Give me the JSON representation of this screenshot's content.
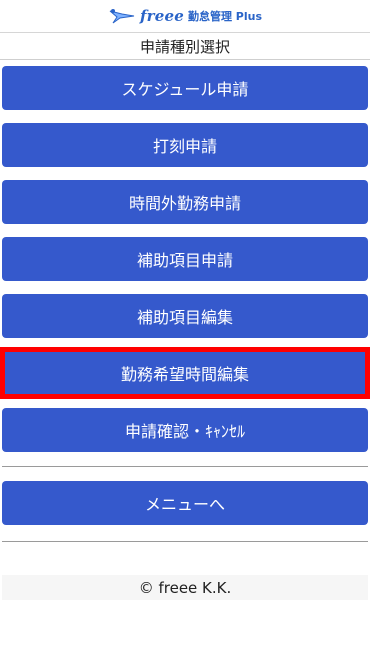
{
  "header": {
    "brand": "freee",
    "product": "勤怠管理 Plus",
    "logo_icon": "freee-bird-logo"
  },
  "page_title": "申請種別選択",
  "menu": {
    "items": [
      {
        "label": "スケジュール申請"
      },
      {
        "label": "打刻申請"
      },
      {
        "label": "時間外勤務申請"
      },
      {
        "label": "補助項目申請"
      },
      {
        "label": "補助項目編集"
      },
      {
        "label": "勤務希望時間編集",
        "highlighted": true
      },
      {
        "label": "申請確認・ｷｬﾝｾﾙ"
      }
    ],
    "back_label": "メニューへ"
  },
  "footer": {
    "copyright": "© freee K.K."
  },
  "colors": {
    "button": "#3559cc",
    "highlight_border": "#ff0000",
    "brand": "#2a64c8"
  }
}
